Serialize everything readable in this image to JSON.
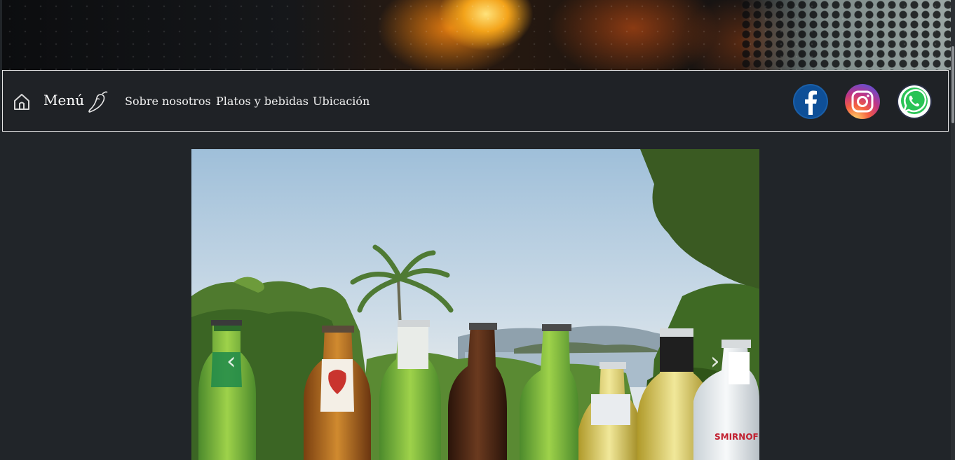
{
  "navbar": {
    "menu_label": "Menú",
    "links": [
      "Sobre nosotros",
      "Platos y bebidas",
      "Ubicación"
    ],
    "icons": [
      "home-icon",
      "chili-pepper-icon"
    ],
    "social": [
      "facebook-icon",
      "instagram-icon",
      "whatsapp-icon"
    ]
  },
  "carousel": {
    "prev_label": "‹",
    "next_label": "›",
    "image": "beer-bottles-over-lake-view",
    "bottle_labels": [
      "SMIRNOFF ICE"
    ]
  },
  "colors": {
    "page_background": "#212529",
    "navbar_border": "#e6e6e6",
    "facebook": "#1877f2",
    "whatsapp": "#25d366"
  }
}
